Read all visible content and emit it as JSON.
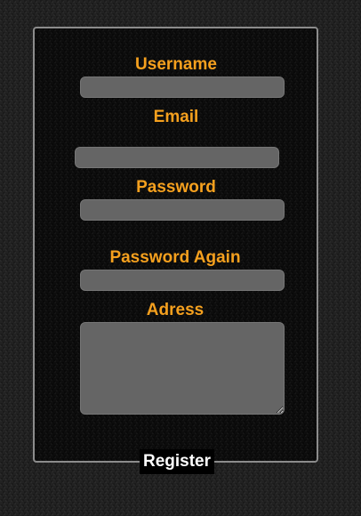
{
  "form": {
    "username_label": "Username",
    "email_label": "Email",
    "password_label": "Password",
    "password_again_label": "Password Again",
    "address_label": "Adress",
    "username_value": "",
    "email_value": "",
    "password_value": "",
    "password_again_value": "",
    "address_value": "",
    "register_label": "Register"
  },
  "colors": {
    "label": "#f5a01e",
    "field": "#656565",
    "panel_border": "#8c8c8c"
  }
}
